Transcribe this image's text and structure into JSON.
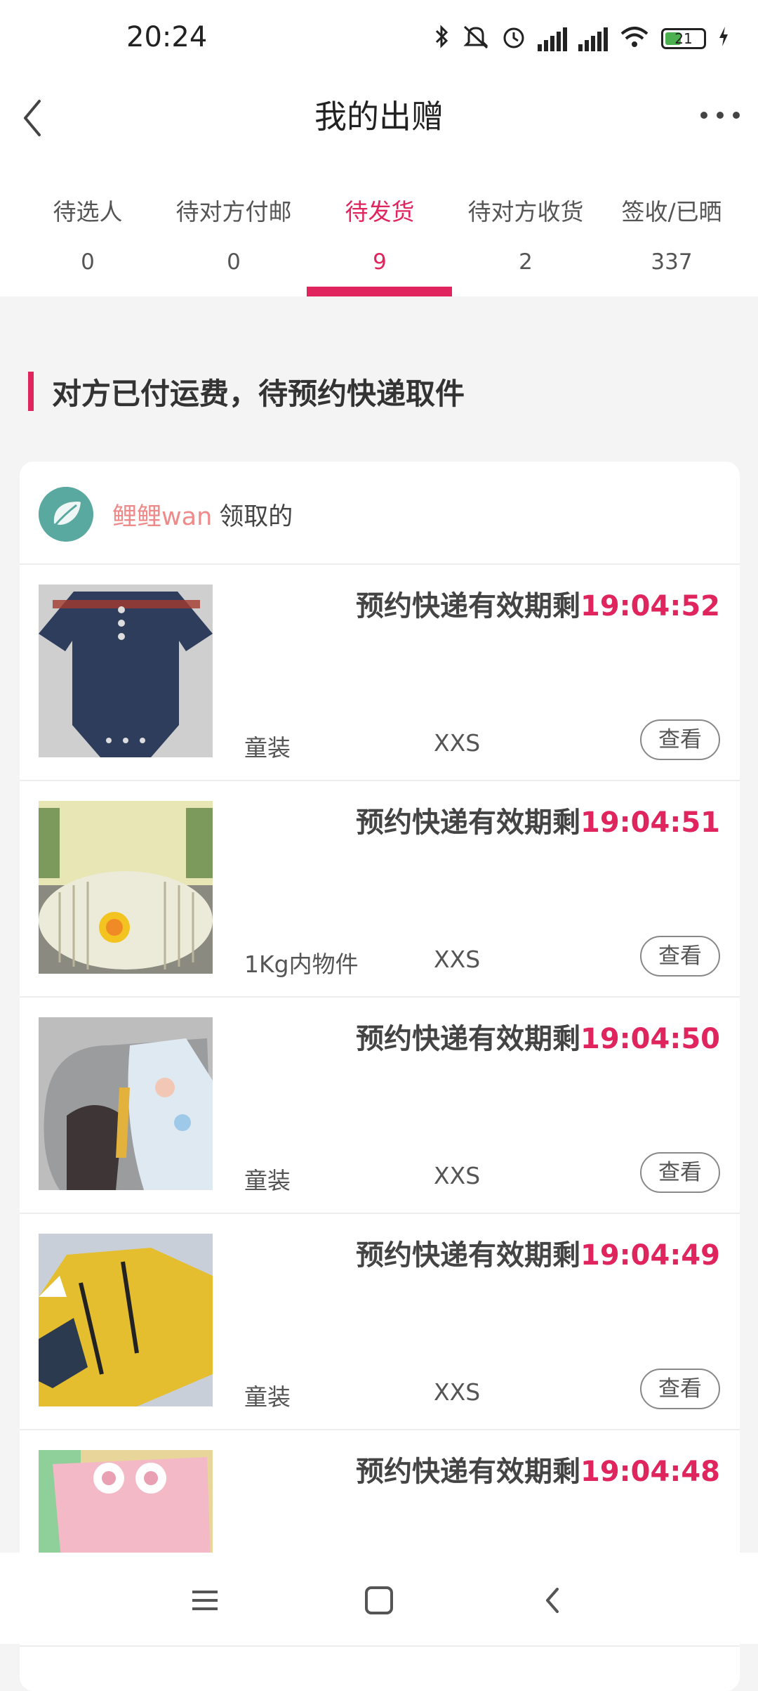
{
  "status_bar": {
    "time": "20:24",
    "battery_level": "21",
    "icons": [
      "bluetooth-icon",
      "mute-icon",
      "alarm-icon",
      "signal-hd-icon",
      "signal-hd-icon",
      "wifi-icon",
      "battery-icon",
      "charging-icon"
    ]
  },
  "header": {
    "title": "我的出赠"
  },
  "tabs": [
    {
      "label": "待选人",
      "count": "0"
    },
    {
      "label": "待对方付邮",
      "count": "0"
    },
    {
      "label": "待发货",
      "count": "9"
    },
    {
      "label": "待对方收货",
      "count": "2"
    },
    {
      "label": "签收/已晒",
      "count": "337"
    }
  ],
  "active_tab_index": 2,
  "section": {
    "title": "对方已付运费，待预约快递取件"
  },
  "order": {
    "recipient_name": "鲤鲤wan",
    "recipient_suffix": "领取的",
    "deadline_prefix": "预约快递有效期剩",
    "view_label": "查看",
    "items": [
      {
        "countdown": "19:04:52",
        "category": "童装",
        "size": "XXS"
      },
      {
        "countdown": "19:04:51",
        "category": "1Kg内物件",
        "size": "XXS"
      },
      {
        "countdown": "19:04:50",
        "category": "童装",
        "size": "XXS"
      },
      {
        "countdown": "19:04:49",
        "category": "童装",
        "size": "XXS"
      },
      {
        "countdown": "19:04:48",
        "category": "",
        "size": ""
      }
    ]
  },
  "colors": {
    "accent": "#e0245e",
    "recipient_name": "#ef8a8a",
    "page_bg": "#f4f4f4"
  }
}
